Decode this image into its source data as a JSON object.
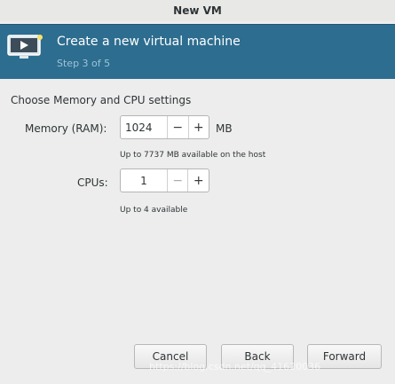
{
  "window": {
    "title": "New VM"
  },
  "banner": {
    "icon": "monitor-play-icon",
    "title": "Create a new virtual machine",
    "step": "Step 3 of 5",
    "color": "#2d6d8f"
  },
  "settings": {
    "section_title": "Choose Memory and CPU settings",
    "memory": {
      "label": "Memory (RAM):",
      "value": "1024",
      "unit": "MB",
      "hint": "Up to 7737 MB available on the host"
    },
    "cpus": {
      "label": "CPUs:",
      "value": "1",
      "hint": "Up to 4 available"
    }
  },
  "footer": {
    "cancel_label": "Cancel",
    "back_label": "Back",
    "forward_label": "Forward"
  },
  "watermark": "https://blog.csdn.net/qq_41620036"
}
